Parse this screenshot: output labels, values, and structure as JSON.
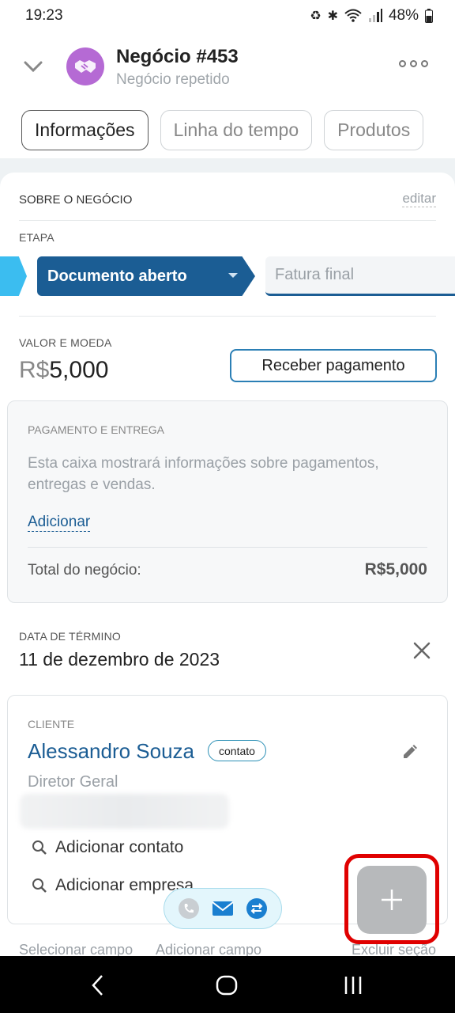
{
  "status_bar": {
    "time": "19:23",
    "battery": "48%",
    "icons": [
      "recycle-icon",
      "bluetooth-icon",
      "wifi-icon",
      "signal-icon",
      "battery-icon"
    ]
  },
  "header": {
    "title": "Negócio #453",
    "subtitle": "Negócio repetido",
    "avatar_icon": "handshake-icon",
    "avatar_color": "#b56ad4"
  },
  "tabs": [
    {
      "label": "Informações",
      "active": true
    },
    {
      "label": "Linha do tempo",
      "active": false
    },
    {
      "label": "Produtos",
      "active": false
    }
  ],
  "about": {
    "section_title": "SOBRE O NEGÓCIO",
    "edit_label": "editar",
    "stage_label": "ETAPA",
    "stage_current": "Documento aberto",
    "stage_next": "Fatura final",
    "stage_colors": {
      "previous": "#3bbdf0",
      "current": "#1b5d94"
    }
  },
  "value": {
    "label": "VALOR E MOEDA",
    "currency": "R$",
    "amount": "5,000",
    "pay_button": "Receber pagamento"
  },
  "payment": {
    "label": "PAGAMENTO E ENTREGA",
    "text": "Esta caixa mostrará informações sobre pagamentos, entregas e vendas.",
    "add_link": "Adicionar",
    "total_label": "Total do negócio:",
    "total_value": "R$5,000"
  },
  "end_date": {
    "label": "DATA DE TÉRMINO",
    "value": "11 de dezembro de 2023"
  },
  "client": {
    "label": "CLIENTE",
    "name": "Alessandro Souza",
    "badge": "contato",
    "role": "Diretor Geral",
    "add_contact": "Adicionar contato",
    "add_company": "Adicionar empresa"
  },
  "footer_links": {
    "select_field": "Selecionar campo",
    "add_field": "Adicionar campo",
    "delete_section": "Excluir seção"
  },
  "accent_color": "#1b5d94",
  "highlight_color": "#e00000"
}
